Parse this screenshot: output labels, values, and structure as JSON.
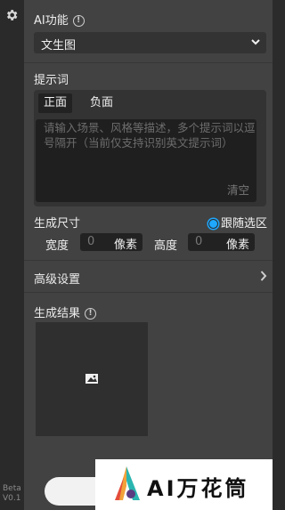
{
  "sidebar": {
    "settings_icon": "gear-icon",
    "version": [
      "Beta",
      "V0.1"
    ]
  },
  "ai_function": {
    "title": "AI功能",
    "selected": "文生图"
  },
  "prompt": {
    "title": "提示词",
    "tabs": [
      "正面",
      "负面"
    ],
    "active_tab": "正面",
    "placeholder": "请输入场景、风格等描述，多个提示词以逗号隔开（当前仅支持识别英文提示词）",
    "clear_label": "清空"
  },
  "size": {
    "title": "生成尺寸",
    "follow_selection_label": "跟随选区",
    "follow_selection_checked": true,
    "width_label": "宽度",
    "width_value": "0",
    "width_unit": "像素",
    "height_label": "高度",
    "height_value": "0",
    "height_unit": "像素"
  },
  "advanced": {
    "title": "高级设置"
  },
  "result": {
    "title": "生成结果",
    "placeholder_icon": "image-icon"
  },
  "watermark": {
    "text": "AI万花筒"
  },
  "colors": {
    "accent": "#1ea7fd",
    "panel": "#424242",
    "sidebar": "#2a2a2a"
  }
}
